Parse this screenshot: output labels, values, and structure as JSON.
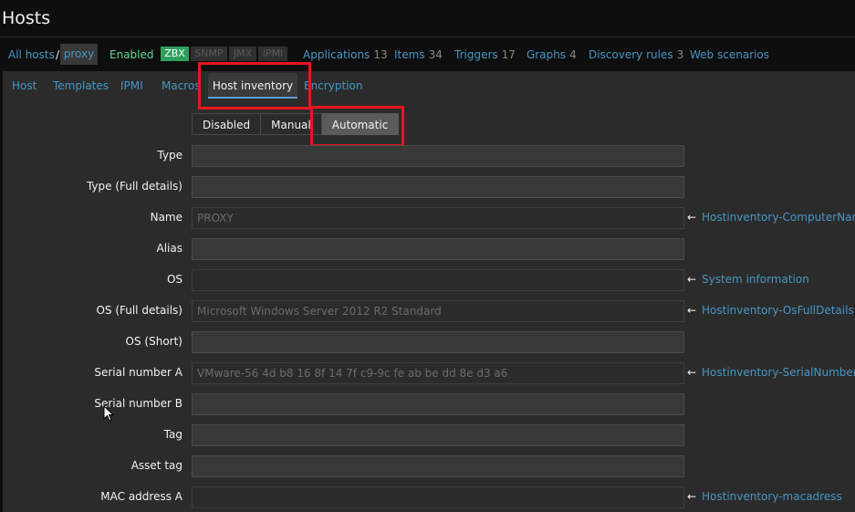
{
  "page": {
    "title": "Hosts"
  },
  "breadcrumb": {
    "all_hosts": "All hosts",
    "separator": "/",
    "current": "proxy"
  },
  "status": {
    "enabled": "Enabled",
    "availability": [
      "ZBX",
      "SNMP",
      "JMX",
      "IPMI"
    ]
  },
  "nav": [
    {
      "label": "Applications",
      "count": "13"
    },
    {
      "label": "Items",
      "count": "34"
    },
    {
      "label": "Triggers",
      "count": "17"
    },
    {
      "label": "Graphs",
      "count": "4"
    },
    {
      "label": "Discovery rules",
      "count": "3"
    },
    {
      "label": "Web scenarios",
      "count": ""
    }
  ],
  "tabs": [
    "Host",
    "Templates",
    "IPMI",
    "Macros",
    "Host inventory",
    "Encryption"
  ],
  "active_tab": "Host inventory",
  "inventory_mode": {
    "options": [
      "Disabled",
      "Manual",
      "Automatic"
    ],
    "selected": "Automatic"
  },
  "fields": [
    {
      "label": "Type",
      "value": "",
      "source": ""
    },
    {
      "label": "Type (Full details)",
      "value": "",
      "source": ""
    },
    {
      "label": "Name",
      "value": "PROXY",
      "source": "Hostinventory-ComputerName"
    },
    {
      "label": "Alias",
      "value": "",
      "source": ""
    },
    {
      "label": "OS",
      "value": "",
      "source": "System information"
    },
    {
      "label": "OS (Full details)",
      "value": "Microsoft Windows Server 2012 R2 Standard",
      "source": "Hostinventory-OsFullDetails"
    },
    {
      "label": "OS (Short)",
      "value": "",
      "source": ""
    },
    {
      "label": "Serial number A",
      "value": "VMware-56 4d b8 16 8f 14 7f c9-9c fe ab be dd 8e d3 a6",
      "source": "Hostinventory-SerialNumberA"
    },
    {
      "label": "Serial number B",
      "value": "",
      "source": ""
    },
    {
      "label": "Tag",
      "value": "",
      "source": ""
    },
    {
      "label": "Asset tag",
      "value": "",
      "source": ""
    },
    {
      "label": "MAC address A",
      "value": "",
      "source": "Hostinventory-macadress"
    }
  ],
  "colors": {
    "link": "#4796c4",
    "enabled": "#59db8f",
    "zbx_badge": "#2f9f5e",
    "highlight": "#e8161e"
  }
}
